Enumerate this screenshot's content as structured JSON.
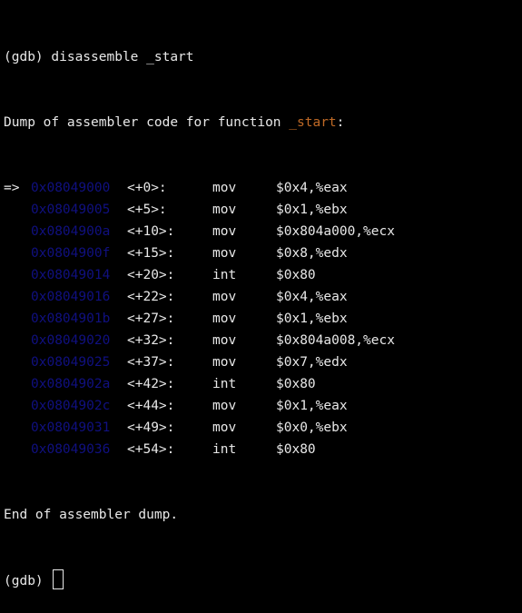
{
  "terminal": {
    "command_line": "(gdb) disassemble _start",
    "dump_header_prefix": "Dump of assembler code for function ",
    "function_name": "_start",
    "dump_header_suffix": ":",
    "current_marker": "=>",
    "rows": [
      {
        "address": "0x08049000",
        "offset": "<+0>:",
        "instr": "mov",
        "operands": "$0x4,%eax"
      },
      {
        "address": "0x08049005",
        "offset": "<+5>:",
        "instr": "mov",
        "operands": "$0x1,%ebx"
      },
      {
        "address": "0x0804900a",
        "offset": "<+10>:",
        "instr": "mov",
        "operands": "$0x804a000,%ecx"
      },
      {
        "address": "0x0804900f",
        "offset": "<+15>:",
        "instr": "mov",
        "operands": "$0x8,%edx"
      },
      {
        "address": "0x08049014",
        "offset": "<+20>:",
        "instr": "int",
        "operands": "$0x80"
      },
      {
        "address": "0x08049016",
        "offset": "<+22>:",
        "instr": "mov",
        "operands": "$0x4,%eax"
      },
      {
        "address": "0x0804901b",
        "offset": "<+27>:",
        "instr": "mov",
        "operands": "$0x1,%ebx"
      },
      {
        "address": "0x08049020",
        "offset": "<+32>:",
        "instr": "mov",
        "operands": "$0x804a008,%ecx"
      },
      {
        "address": "0x08049025",
        "offset": "<+37>:",
        "instr": "mov",
        "operands": "$0x7,%edx"
      },
      {
        "address": "0x0804902a",
        "offset": "<+42>:",
        "instr": "int",
        "operands": "$0x80"
      },
      {
        "address": "0x0804902c",
        "offset": "<+44>:",
        "instr": "mov",
        "operands": "$0x1,%eax"
      },
      {
        "address": "0x08049031",
        "offset": "<+49>:",
        "instr": "mov",
        "operands": "$0x0,%ebx"
      },
      {
        "address": "0x08049036",
        "offset": "<+54>:",
        "instr": "int",
        "operands": "$0x80"
      }
    ],
    "end_line": "End of assembler dump.",
    "prompt": "(gdb)",
    "colors": {
      "background": "#000000",
      "text": "#e8e8e8",
      "address": "#101080",
      "function_name": "#c06a26"
    }
  }
}
